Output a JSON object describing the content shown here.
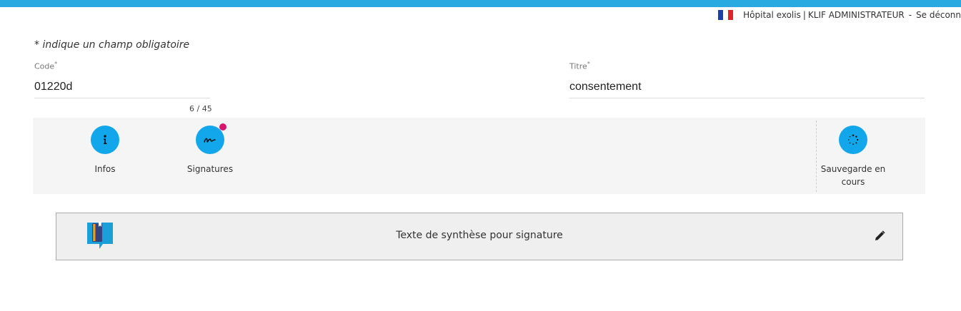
{
  "header": {
    "accent_color": "#29abe2",
    "language_flag": "french-flag-icon",
    "hospital": "Hôpital exolis",
    "separator1": "|",
    "user": "KLIF ADMINISTRATEUR",
    "separator2": "-",
    "logout": "Se déconn"
  },
  "form": {
    "required_note": "* indique un champ obligatoire",
    "code": {
      "label": "Code",
      "required_mark": "*",
      "value": "01220d",
      "counter": "6 / 45"
    },
    "titre": {
      "label": "Titre",
      "required_mark": "*",
      "value": "consentement"
    }
  },
  "toolbar": {
    "items": [
      {
        "label": "Infos",
        "icon": "info-icon"
      },
      {
        "label": "Signatures",
        "icon": "signature-icon",
        "badge_color": "#d6186f"
      },
      {
        "label": "Sauvegarde en cours",
        "icon": "saving-spinner-icon"
      }
    ],
    "button_color": "#12a7ea"
  },
  "synthesis": {
    "title": "Texte de synthèse pour signature",
    "icon": "notebook-icon",
    "edit_icon": "pencil-icon"
  }
}
